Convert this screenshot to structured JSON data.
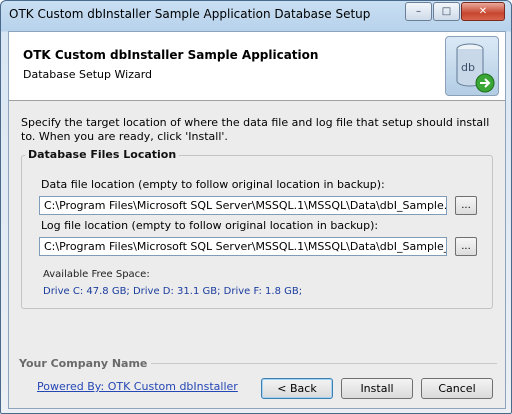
{
  "window": {
    "title": "OTK Custom dbInstaller Sample Application Database Setup",
    "caption": {
      "minimize": "–",
      "maximize": "□",
      "close": "✕"
    }
  },
  "header": {
    "title": "OTK Custom dbInstaller Sample Application",
    "subtitle": "Database Setup Wizard",
    "logo_text": "db",
    "logo_icon": "database-arrow-icon"
  },
  "description": "Specify the target location of where the data file and log file that setup should install to. When you are ready, click 'Install'.",
  "files": {
    "group_title": "Database Files Location",
    "data_label": "Data file location (empty to follow original location in backup):",
    "data_value": "C:\\Program Files\\Microsoft SQL Server\\MSSQL.1\\MSSQL\\Data\\dbI_Sample.mdf",
    "log_label": "Log file location (empty to follow original location in backup):",
    "log_value": "C:\\Program Files\\Microsoft SQL Server\\MSSQL.1\\MSSQL\\Data\\dbI_Sample_log.ldf",
    "browse_label": "...",
    "free_space_label": "Available Free Space:",
    "free_space_value": "Drive C: 47.8 GB; Drive D: 31.1 GB; Drive F: 1.8 GB;"
  },
  "footer": {
    "company": "Your Company Name",
    "powered_by": "Powered By: OTK Custom dbInstaller",
    "back_label": "< Back",
    "install_label": "Install",
    "cancel_label": "Cancel"
  },
  "colors": {
    "link": "#2547b4",
    "free_space": "#1a3c9e",
    "arrow": "#3aa635"
  }
}
